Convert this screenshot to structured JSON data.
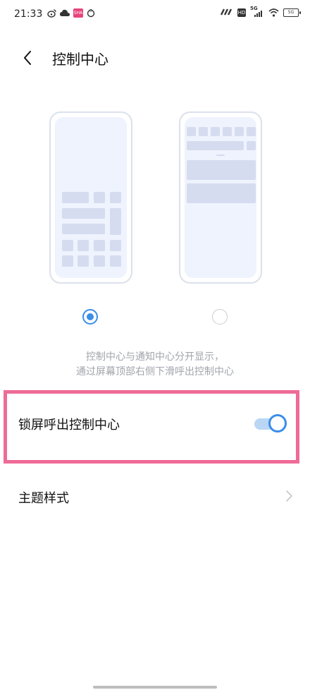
{
  "status_bar": {
    "time": "21:33",
    "left_icons": [
      "weibo-icon",
      "cloud-icon",
      "app-notification-icon",
      "sync-icon"
    ],
    "right_icons": [
      "nfc-icon",
      "hd-icon",
      "signal-5g-icon",
      "wifi-icon",
      "battery-icon"
    ],
    "signal_label": "5G",
    "hd_label": "HD",
    "battery_label": "5G",
    "app_badge_label": "SHA"
  },
  "header": {
    "title": "控制中心",
    "back_icon": "chevron-left-icon"
  },
  "mode_options": [
    {
      "name": "combined-mode",
      "selected": true
    },
    {
      "name": "separate-mode",
      "selected": false
    }
  ],
  "description": {
    "line1": "控制中心与通知中心分开显示，",
    "line2": "通过屏幕顶部右侧下滑呼出控制中心"
  },
  "settings": {
    "lockscreen_control_center": {
      "label": "锁屏呼出控制中心",
      "enabled": true
    },
    "theme_style": {
      "label": "主题样式"
    }
  },
  "colors": {
    "accent": "#3a8ee8",
    "highlight": "#ee6b96",
    "preview_bg": "#eef3fd",
    "preview_block": "#d6dcf0"
  }
}
